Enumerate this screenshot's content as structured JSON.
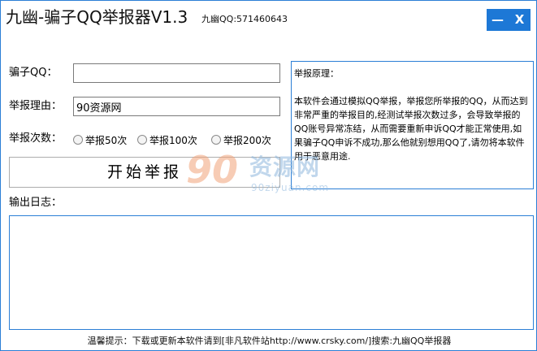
{
  "window": {
    "title": "九幽-骗子QQ举报器V1.3",
    "subtitle": "九幽QQ:571460643",
    "minimize_label": "—",
    "close_label": "X"
  },
  "form": {
    "scammer_qq_label": "骗子QQ：",
    "scammer_qq_value": "",
    "reason_label": "举报理由：",
    "reason_value": "90资源网",
    "count_label": "举报次数：",
    "count_options": [
      "举报50次",
      "举报100次",
      "举报200次"
    ],
    "start_button": "开始举报",
    "log_label": "输出日志："
  },
  "info_panel": {
    "heading": "举报原理：",
    "body": "本软件会通过模拟QQ举报，举报您所举报的QQ，从而达到非常严重的举报目的,经测试举报次数过多，会导致举报的QQ账号异常冻结，从而需要重新申诉QQ才能正常使用,如果骗子QQ申诉不成功,那么他就别想用QQ了,请勿将本软件用于恶意用途."
  },
  "footer": {
    "text": "温馨提示：下载或更新本软件请到[非凡软件站http://www.crsky.com/]搜索:九幽QQ举报器"
  },
  "watermark": {
    "number": "90",
    "name": "资源网",
    "url": "90ziyuan.com"
  },
  "colors": {
    "accent": "#1d78d6",
    "border": "#2b7fd6"
  }
}
